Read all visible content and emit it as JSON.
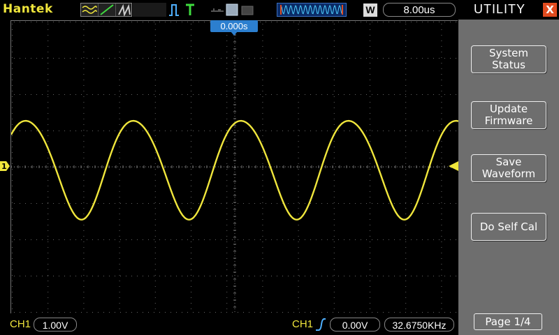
{
  "header": {
    "brand": "Hantek",
    "timebase": "8.00us",
    "window_badge": "W"
  },
  "menu": {
    "title": "UTILITY",
    "close_symbol": "X",
    "buttons": [
      {
        "label": "System\nStatus"
      },
      {
        "label": "Update\nFirmware"
      },
      {
        "label": "Save\nWaveform"
      },
      {
        "label": "Do Self Cal"
      }
    ],
    "page": "Page 1/4"
  },
  "screen": {
    "trigger_position": "0.000s",
    "ch1_marker": "1"
  },
  "status": {
    "ch1_label": "CH1",
    "ch1_scale": "1.00V",
    "trigger_channel": "CH1",
    "trigger_level": "0.00V",
    "frequency": "32.6750KHz"
  },
  "colors": {
    "trace": "#f0e63c",
    "menu_bg": "#6e6e6e",
    "close": "#e24b1f",
    "trigger_marker": "#2c7fcf"
  }
}
